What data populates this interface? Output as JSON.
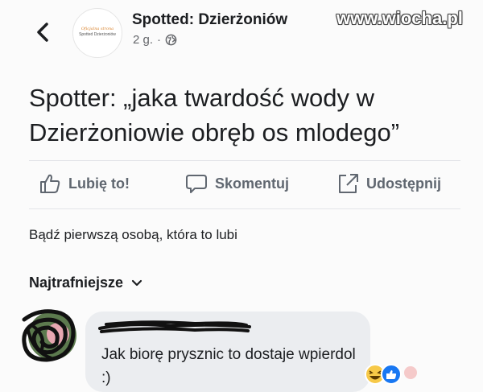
{
  "header": {
    "page_name": "Spotted: Dzierżoniów",
    "time": "2 g.",
    "separator": "·",
    "avatar_line1": "Oficjalna strona",
    "avatar_line2": "Spotted Dzierżoniów"
  },
  "watermark": "www.wiocha.pl",
  "post": {
    "text": "Spotter: „jaka twardość wody w Dzierżoniowie obręb os mlodego”"
  },
  "actions": {
    "like": "Lubię to!",
    "comment": "Skomentuj",
    "share": "Udostępnij"
  },
  "likes_info": "Bądź pierwszą osobą, która to lubi",
  "comments_sort": "Najtrafniejsze",
  "comment": {
    "text": "Jak biorę prysznic to dostaje wpierdol :)"
  },
  "colors": {
    "background": "#fbfbfb",
    "text": "#1c1e21",
    "muted": "#65676b",
    "action_gray": "#606770",
    "bubble": "#ebedf0"
  }
}
